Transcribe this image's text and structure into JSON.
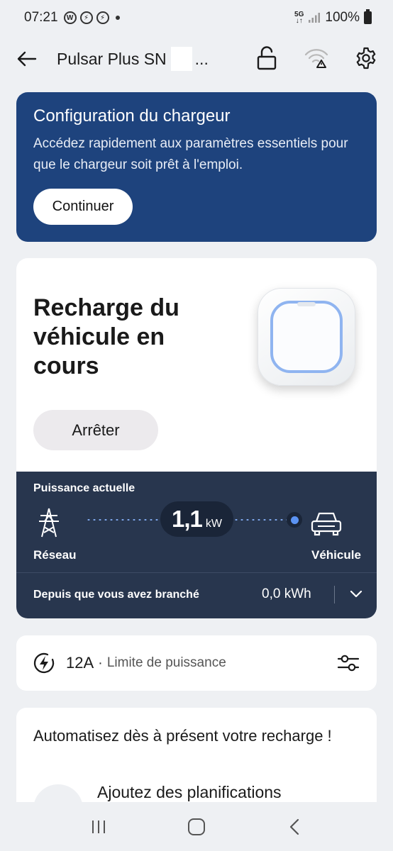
{
  "status_bar": {
    "time": "07:21",
    "network": "5G",
    "battery": "100%"
  },
  "app_bar": {
    "title_prefix": "Pulsar Plus SN",
    "title_suffix": "...",
    "icons": [
      "back-arrow-icon",
      "lock-open-icon",
      "wifi-warning-icon",
      "gear-icon"
    ]
  },
  "setup_banner": {
    "title": "Configuration du chargeur",
    "description": "Accédez rapidement aux paramètres essentiels pour que le chargeur soit prêt à l'emploi.",
    "button": "Continuer",
    "bg_color": "#1e437d"
  },
  "charging": {
    "title": "Recharge du véhicule en cours",
    "stop_button": "Arrêter",
    "current_power_label": "Puissance actuelle",
    "power_value": "1,1",
    "power_unit": "kW",
    "grid_label": "Réseau",
    "vehicle_label": "Véhicule",
    "since_plugged_label": "Depuis que vous avez branché",
    "energy_value": "0,0 kWh",
    "panel_color": "#28364e",
    "flow_color": "#5b93f3"
  },
  "power_limit": {
    "value": "12A",
    "separator": "·",
    "label": "Limite de puissance",
    "icons": [
      "lightning-circle-icon",
      "sliders-icon"
    ]
  },
  "automation": {
    "title": "Automatisez dès à présent votre recharge !",
    "item": "Ajoutez des planifications"
  },
  "nav_bar": {
    "icons": [
      "recents-icon",
      "home-icon",
      "back-icon"
    ]
  }
}
